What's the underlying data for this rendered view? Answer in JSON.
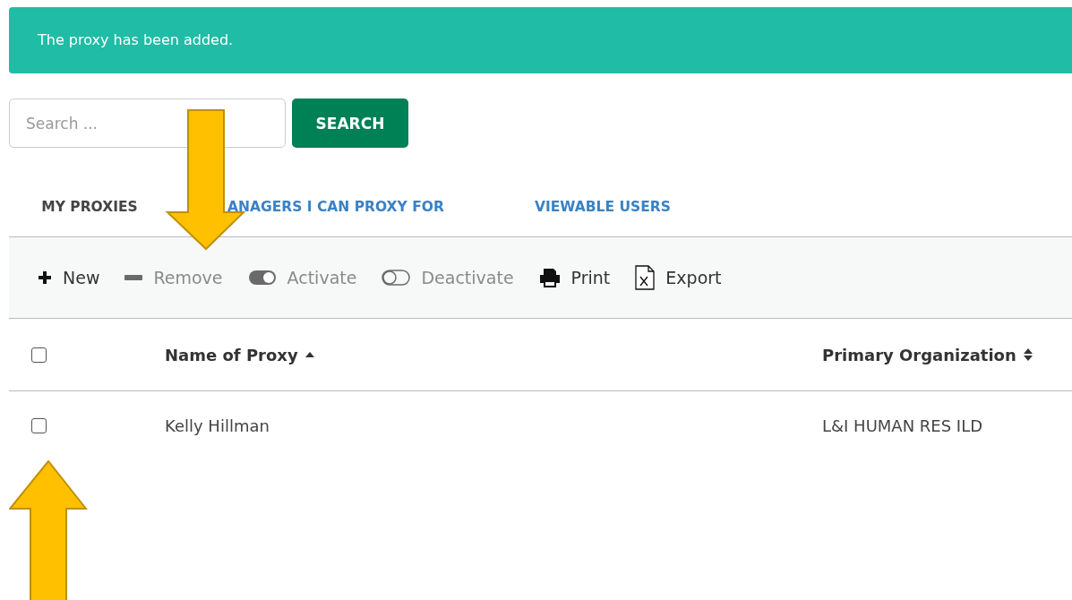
{
  "alert": {
    "message": "The proxy has been added."
  },
  "search": {
    "placeholder": "Search ...",
    "button": "SEARCH"
  },
  "tabs": [
    {
      "label": "MY PROXIES",
      "selected": true
    },
    {
      "label": "ANAGERS I CAN PROXY FOR",
      "selected": false
    },
    {
      "label": "VIEWABLE USERS",
      "selected": false
    }
  ],
  "toolbar": [
    {
      "kind": "new",
      "label": "New",
      "disabled": false
    },
    {
      "kind": "remove",
      "label": "Remove",
      "disabled": true
    },
    {
      "kind": "activate",
      "label": "Activate",
      "disabled": true
    },
    {
      "kind": "deactivate",
      "label": "Deactivate",
      "disabled": true
    },
    {
      "kind": "print",
      "label": "Print",
      "disabled": false
    },
    {
      "kind": "export",
      "label": "Export",
      "disabled": false
    }
  ],
  "table": {
    "select_all_checked": false,
    "columns": [
      {
        "label": "Name of Proxy",
        "sorted": true
      },
      {
        "label": "Primary Organization",
        "sorted": false
      }
    ],
    "rows": [
      {
        "checked": false,
        "name": "Kelly Hillman",
        "organization": "L&I HUMAN RES ILD"
      }
    ]
  }
}
